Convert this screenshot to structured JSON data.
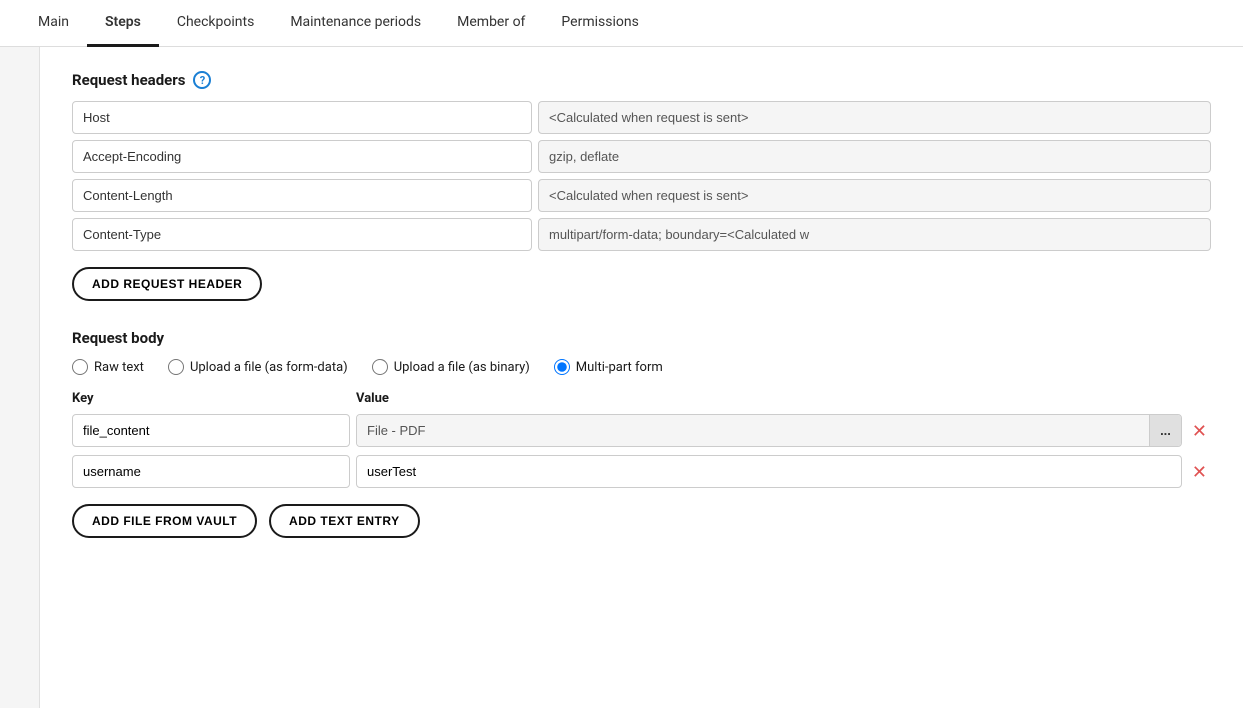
{
  "tabs": [
    {
      "id": "main",
      "label": "Main",
      "active": false
    },
    {
      "id": "steps",
      "label": "Steps",
      "active": true
    },
    {
      "id": "checkpoints",
      "label": "Checkpoints",
      "active": false
    },
    {
      "id": "maintenance",
      "label": "Maintenance periods",
      "active": false
    },
    {
      "id": "member-of",
      "label": "Member of",
      "active": false
    },
    {
      "id": "permissions",
      "label": "Permissions",
      "active": false
    }
  ],
  "request_headers": {
    "section_title": "Request headers",
    "help_text": "?",
    "rows": [
      {
        "key": "Host",
        "value": "<Calculated when request is sent>"
      },
      {
        "key": "Accept-Encoding",
        "value": "gzip, deflate"
      },
      {
        "key": "Content-Length",
        "value": "<Calculated when request is sent>"
      },
      {
        "key": "Content-Type",
        "value": "multipart/form-data; boundary=<Calculated w"
      }
    ],
    "add_button_label": "ADD REQUEST HEADER"
  },
  "request_body": {
    "section_title": "Request body",
    "radio_options": [
      {
        "id": "raw-text",
        "label": "Raw text",
        "checked": false
      },
      {
        "id": "upload-form-data",
        "label": "Upload a file (as form-data)",
        "checked": false
      },
      {
        "id": "upload-binary",
        "label": "Upload a file (as binary)",
        "checked": false
      },
      {
        "id": "multi-part",
        "label": "Multi-part form",
        "checked": true
      }
    ],
    "kv_columns": {
      "key": "Key",
      "value": "Value"
    },
    "rows": [
      {
        "key": "file_content",
        "value": "File - PDF",
        "has_browse": true,
        "browse_label": "..."
      },
      {
        "key": "username",
        "value": "userTest",
        "has_browse": false
      }
    ],
    "add_vault_button_label": "ADD FILE FROM VAULT",
    "add_text_button_label": "ADD TEXT ENTRY"
  }
}
